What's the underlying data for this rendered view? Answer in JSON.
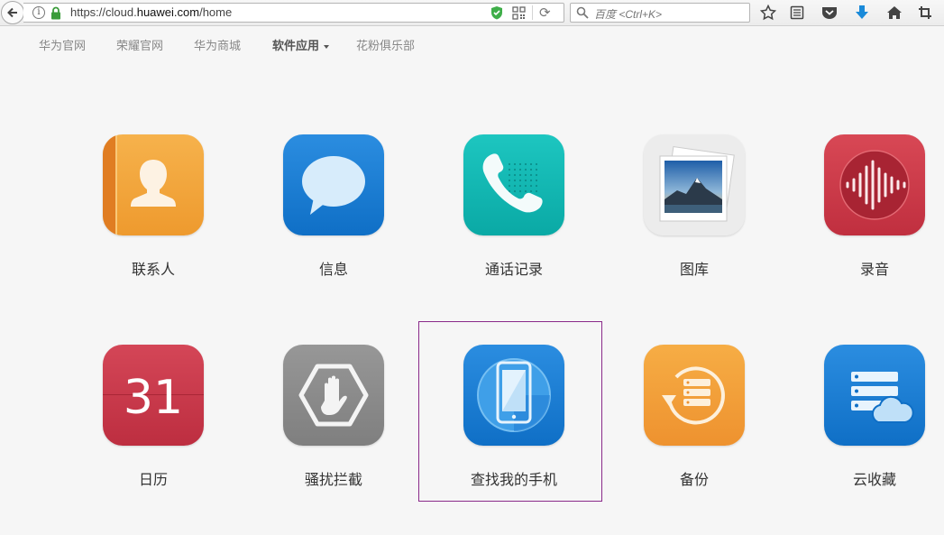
{
  "browser": {
    "url_prefix": "https://cloud.",
    "url_domain": "huawei.com",
    "url_path": "/home",
    "search_placeholder": "百度 <Ctrl+K>"
  },
  "nav": {
    "items": [
      {
        "label": "华为官网"
      },
      {
        "label": "荣耀官网"
      },
      {
        "label": "华为商城"
      },
      {
        "label": "软件应用"
      },
      {
        "label": "花粉俱乐部"
      }
    ]
  },
  "apps": [
    {
      "label": "联系人",
      "icon": "contacts-icon",
      "color": "#f2a33b"
    },
    {
      "label": "信息",
      "icon": "messages-icon",
      "color": "#1a7fd4"
    },
    {
      "label": "通话记录",
      "icon": "call-log-icon",
      "color": "#14b7b2"
    },
    {
      "label": "图库",
      "icon": "gallery-icon",
      "color": "#ececec"
    },
    {
      "label": "录音",
      "icon": "recorder-icon",
      "color": "#cc3b4a"
    },
    {
      "label": "日历",
      "icon": "calendar-icon",
      "color": "#c8384a",
      "day": "31"
    },
    {
      "label": "骚扰拦截",
      "icon": "block-icon",
      "color": "#8c8c8c"
    },
    {
      "label": "查找我的手机",
      "icon": "find-phone-icon",
      "color": "#1a7fd4"
    },
    {
      "label": "备份",
      "icon": "backup-icon",
      "color": "#f29a37"
    },
    {
      "label": "云收藏",
      "icon": "cloud-favorites-icon",
      "color": "#1a7fd4"
    }
  ]
}
